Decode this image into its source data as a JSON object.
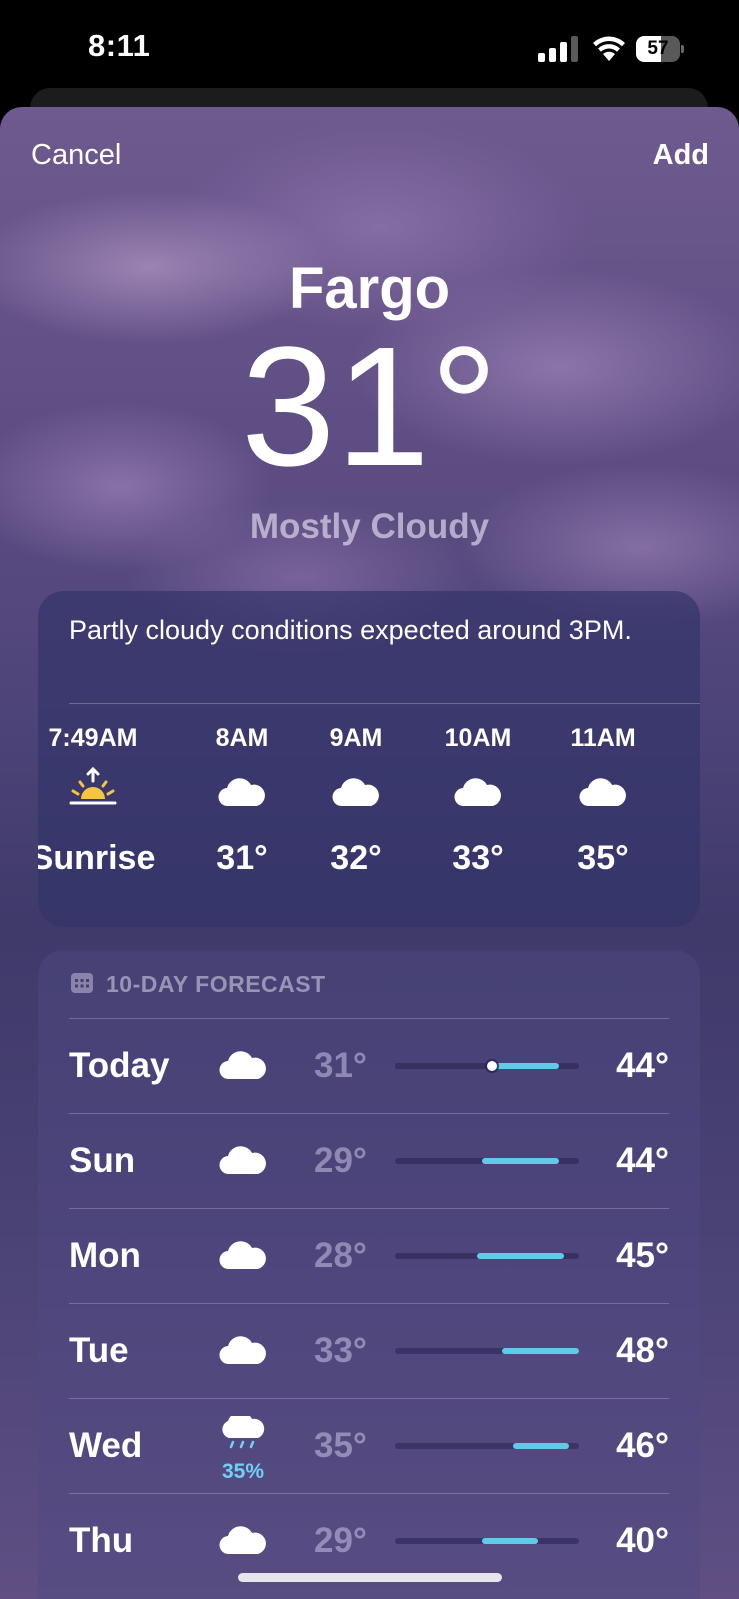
{
  "status": {
    "time": "8:11",
    "battery": "57",
    "battery_level": 0.57
  },
  "nav": {
    "cancel": "Cancel",
    "add": "Add"
  },
  "current": {
    "city": "Fargo",
    "temp": "31°",
    "condition": "Mostly Cloudy"
  },
  "hourly": {
    "summary": "Partly cloudy conditions expected around 3PM.",
    "items": [
      {
        "time": "7:49AM",
        "icon": "sunrise-icon",
        "value": "Sunrise"
      },
      {
        "time": "8AM",
        "icon": "cloud-icon",
        "value": "31°"
      },
      {
        "time": "9AM",
        "icon": "cloud-icon",
        "value": "32°"
      },
      {
        "time": "10AM",
        "icon": "cloud-icon",
        "value": "33°"
      },
      {
        "time": "11AM",
        "icon": "cloud-icon",
        "value": "35°"
      }
    ]
  },
  "forecast": {
    "header": "10-DAY FORECAST",
    "days": [
      {
        "day": "Today",
        "icon": "cloud-icon",
        "precip": "",
        "low": "31°",
        "high": "44°",
        "range_low": 31,
        "range_high": 44,
        "current": 31
      },
      {
        "day": "Sun",
        "icon": "cloud-icon",
        "precip": "",
        "low": "29°",
        "high": "44°",
        "range_low": 29,
        "range_high": 44
      },
      {
        "day": "Mon",
        "icon": "cloud-icon",
        "precip": "",
        "low": "28°",
        "high": "45°",
        "range_low": 28,
        "range_high": 45
      },
      {
        "day": "Tue",
        "icon": "cloud-icon",
        "precip": "",
        "low": "33°",
        "high": "48°",
        "range_low": 33,
        "range_high": 48
      },
      {
        "day": "Wed",
        "icon": "cloud-rain-icon",
        "precip": "35%",
        "low": "35°",
        "high": "46°",
        "range_low": 35,
        "range_high": 46
      },
      {
        "day": "Thu",
        "icon": "cloud-icon",
        "precip": "",
        "low": "29°",
        "high": "40°",
        "range_low": 29,
        "range_high": 40
      }
    ],
    "scale_min": 12,
    "scale_max": 48
  },
  "colors": {
    "range_bar": "#5fcbe8",
    "precip": "#6fd1f7",
    "sunrise": "#f5c542"
  }
}
